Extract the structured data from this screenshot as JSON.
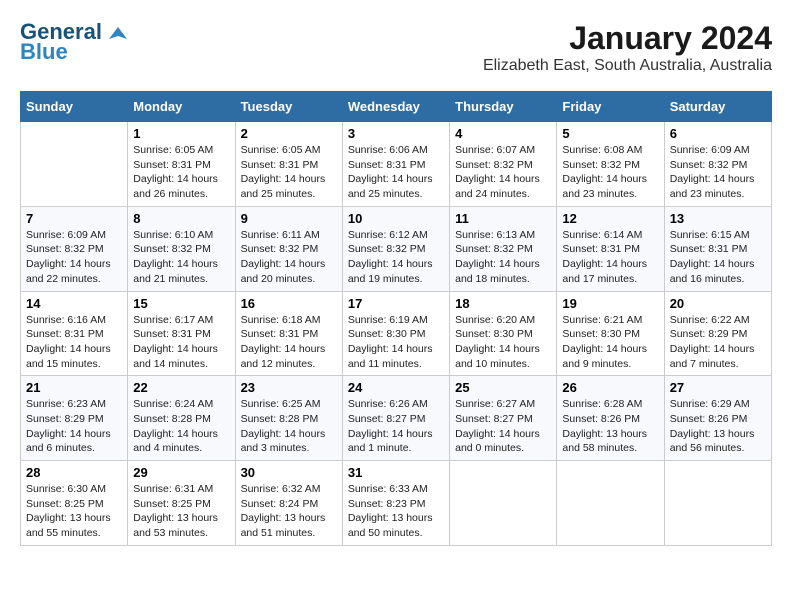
{
  "app": {
    "logo_general": "General",
    "logo_blue": "Blue",
    "title": "January 2024",
    "subtitle": "Elizabeth East, South Australia, Australia"
  },
  "calendar": {
    "headers": [
      "Sunday",
      "Monday",
      "Tuesday",
      "Wednesday",
      "Thursday",
      "Friday",
      "Saturday"
    ],
    "weeks": [
      [
        {
          "day": "",
          "info": ""
        },
        {
          "day": "1",
          "info": "Sunrise: 6:05 AM\nSunset: 8:31 PM\nDaylight: 14 hours\nand 26 minutes."
        },
        {
          "day": "2",
          "info": "Sunrise: 6:05 AM\nSunset: 8:31 PM\nDaylight: 14 hours\nand 25 minutes."
        },
        {
          "day": "3",
          "info": "Sunrise: 6:06 AM\nSunset: 8:31 PM\nDaylight: 14 hours\nand 25 minutes."
        },
        {
          "day": "4",
          "info": "Sunrise: 6:07 AM\nSunset: 8:32 PM\nDaylight: 14 hours\nand 24 minutes."
        },
        {
          "day": "5",
          "info": "Sunrise: 6:08 AM\nSunset: 8:32 PM\nDaylight: 14 hours\nand 23 minutes."
        },
        {
          "day": "6",
          "info": "Sunrise: 6:09 AM\nSunset: 8:32 PM\nDaylight: 14 hours\nand 23 minutes."
        }
      ],
      [
        {
          "day": "7",
          "info": "Sunrise: 6:09 AM\nSunset: 8:32 PM\nDaylight: 14 hours\nand 22 minutes."
        },
        {
          "day": "8",
          "info": "Sunrise: 6:10 AM\nSunset: 8:32 PM\nDaylight: 14 hours\nand 21 minutes."
        },
        {
          "day": "9",
          "info": "Sunrise: 6:11 AM\nSunset: 8:32 PM\nDaylight: 14 hours\nand 20 minutes."
        },
        {
          "day": "10",
          "info": "Sunrise: 6:12 AM\nSunset: 8:32 PM\nDaylight: 14 hours\nand 19 minutes."
        },
        {
          "day": "11",
          "info": "Sunrise: 6:13 AM\nSunset: 8:32 PM\nDaylight: 14 hours\nand 18 minutes."
        },
        {
          "day": "12",
          "info": "Sunrise: 6:14 AM\nSunset: 8:31 PM\nDaylight: 14 hours\nand 17 minutes."
        },
        {
          "day": "13",
          "info": "Sunrise: 6:15 AM\nSunset: 8:31 PM\nDaylight: 14 hours\nand 16 minutes."
        }
      ],
      [
        {
          "day": "14",
          "info": "Sunrise: 6:16 AM\nSunset: 8:31 PM\nDaylight: 14 hours\nand 15 minutes."
        },
        {
          "day": "15",
          "info": "Sunrise: 6:17 AM\nSunset: 8:31 PM\nDaylight: 14 hours\nand 14 minutes."
        },
        {
          "day": "16",
          "info": "Sunrise: 6:18 AM\nSunset: 8:31 PM\nDaylight: 14 hours\nand 12 minutes."
        },
        {
          "day": "17",
          "info": "Sunrise: 6:19 AM\nSunset: 8:30 PM\nDaylight: 14 hours\nand 11 minutes."
        },
        {
          "day": "18",
          "info": "Sunrise: 6:20 AM\nSunset: 8:30 PM\nDaylight: 14 hours\nand 10 minutes."
        },
        {
          "day": "19",
          "info": "Sunrise: 6:21 AM\nSunset: 8:30 PM\nDaylight: 14 hours\nand 9 minutes."
        },
        {
          "day": "20",
          "info": "Sunrise: 6:22 AM\nSunset: 8:29 PM\nDaylight: 14 hours\nand 7 minutes."
        }
      ],
      [
        {
          "day": "21",
          "info": "Sunrise: 6:23 AM\nSunset: 8:29 PM\nDaylight: 14 hours\nand 6 minutes."
        },
        {
          "day": "22",
          "info": "Sunrise: 6:24 AM\nSunset: 8:28 PM\nDaylight: 14 hours\nand 4 minutes."
        },
        {
          "day": "23",
          "info": "Sunrise: 6:25 AM\nSunset: 8:28 PM\nDaylight: 14 hours\nand 3 minutes."
        },
        {
          "day": "24",
          "info": "Sunrise: 6:26 AM\nSunset: 8:27 PM\nDaylight: 14 hours\nand 1 minute."
        },
        {
          "day": "25",
          "info": "Sunrise: 6:27 AM\nSunset: 8:27 PM\nDaylight: 14 hours\nand 0 minutes."
        },
        {
          "day": "26",
          "info": "Sunrise: 6:28 AM\nSunset: 8:26 PM\nDaylight: 13 hours\nand 58 minutes."
        },
        {
          "day": "27",
          "info": "Sunrise: 6:29 AM\nSunset: 8:26 PM\nDaylight: 13 hours\nand 56 minutes."
        }
      ],
      [
        {
          "day": "28",
          "info": "Sunrise: 6:30 AM\nSunset: 8:25 PM\nDaylight: 13 hours\nand 55 minutes."
        },
        {
          "day": "29",
          "info": "Sunrise: 6:31 AM\nSunset: 8:25 PM\nDaylight: 13 hours\nand 53 minutes."
        },
        {
          "day": "30",
          "info": "Sunrise: 6:32 AM\nSunset: 8:24 PM\nDaylight: 13 hours\nand 51 minutes."
        },
        {
          "day": "31",
          "info": "Sunrise: 6:33 AM\nSunset: 8:23 PM\nDaylight: 13 hours\nand 50 minutes."
        },
        {
          "day": "",
          "info": ""
        },
        {
          "day": "",
          "info": ""
        },
        {
          "day": "",
          "info": ""
        }
      ]
    ]
  }
}
